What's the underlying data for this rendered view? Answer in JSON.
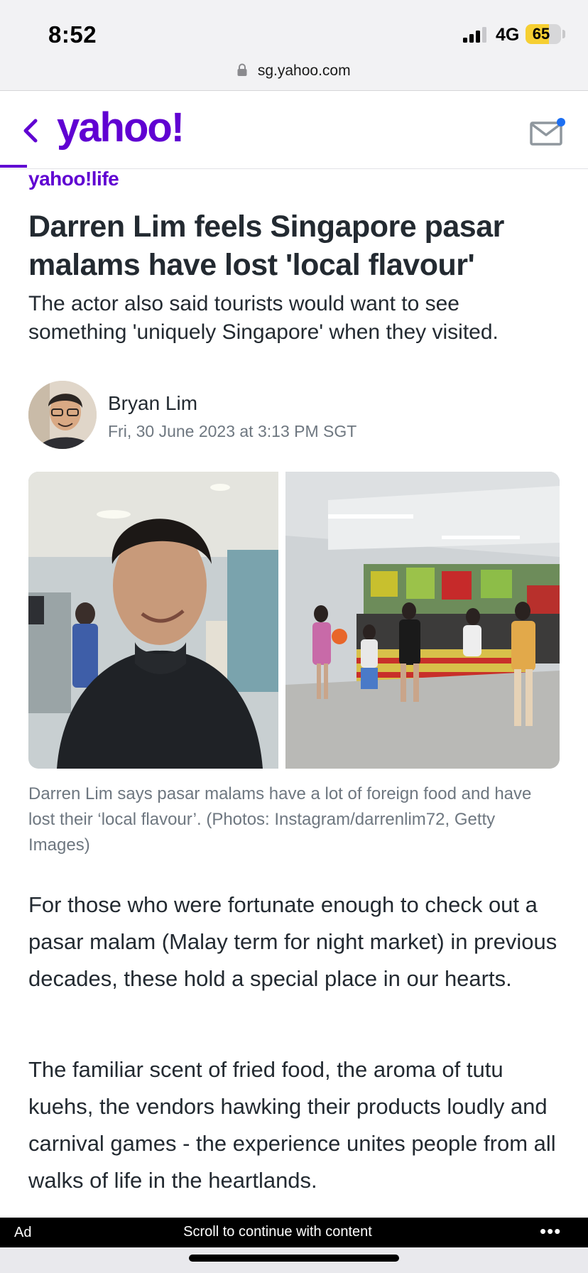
{
  "status_bar": {
    "time": "8:52",
    "network": "4G",
    "battery": "65",
    "battery_level": 0.65
  },
  "url_bar": {
    "url": "sg.yahoo.com"
  },
  "header": {
    "logo": "yahoo!",
    "brand_color": "#6001d2"
  },
  "article": {
    "section_logo": "yahoo!life",
    "headline": "Darren Lim feels Singapore pasar malams have lost 'local flavour'",
    "subheadline": "The actor also said tourists would want to see something 'uniquely Singapore' when they visited.",
    "author": {
      "name": "Bryan Lim",
      "date": "Fri, 30 June 2023 at 3:13 PM SGT"
    },
    "caption": "Darren Lim says pasar malams have a lot of foreign food and have lost their ‘local flavour’. (Photos: Instagram/darrenlim72, Getty Images)",
    "paragraphs": [
      "For those who were fortunate enough to check out a pasar malam (Malay term for night market) in previous decades, these hold a special place in our hearts.",
      "The familiar scent of fried food, the aroma of tutu kuehs, the vendors hawking their products loudly and carnival games - the experience unites people from all walks of life in the heartlands."
    ]
  },
  "ad_bar": {
    "label": "Ad",
    "message": "Scroll to continue with content",
    "more": "•••"
  }
}
